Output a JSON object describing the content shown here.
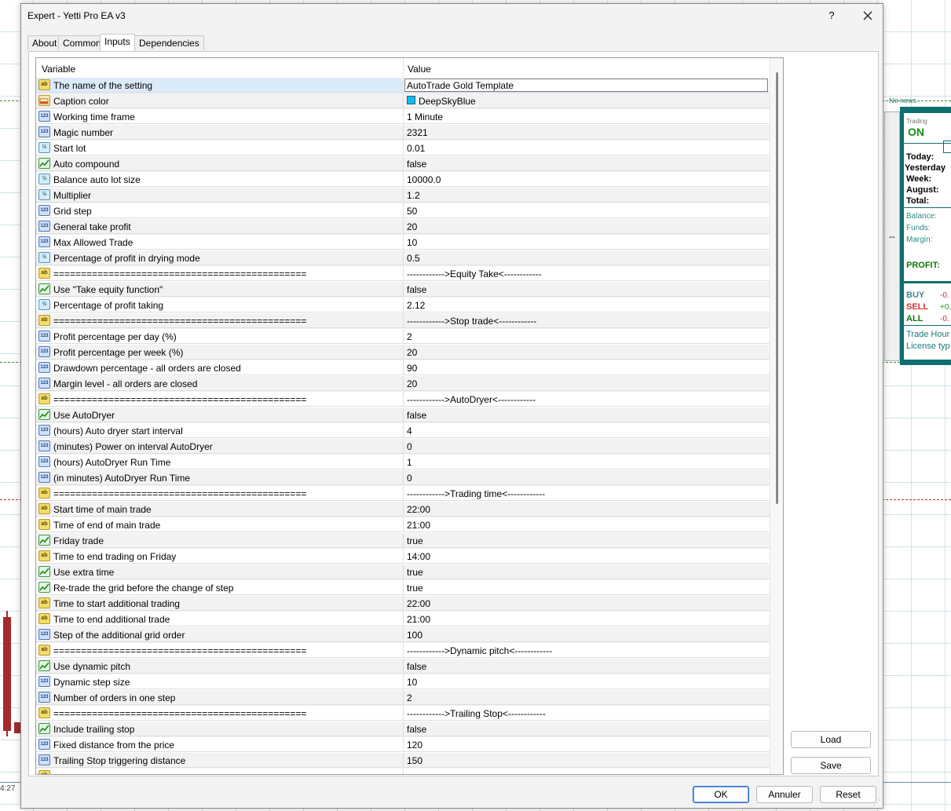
{
  "dialog": {
    "title": "Expert - Yetti Pro EA v3",
    "help_label": "?",
    "tabs": [
      {
        "label": "About"
      },
      {
        "label": "Common"
      },
      {
        "label": "Inputs"
      },
      {
        "label": "Dependencies"
      }
    ],
    "active_tab": "Inputs",
    "buttons": {
      "load": "Load",
      "save": "Save",
      "ok": "OK",
      "cancel": "Annuler",
      "reset": "Reset"
    }
  },
  "grid": {
    "columns": {
      "variable": "Variable",
      "value": "Value"
    },
    "rows": [
      {
        "icon": "ab",
        "variable": "The name of the setting",
        "value": "AutoTrade Gold Template",
        "editing": true
      },
      {
        "icon": "color",
        "variable": "Caption color",
        "value": "DeepSkyBlue",
        "swatch": "#00bfff"
      },
      {
        "icon": "n123",
        "variable": "Working time frame",
        "value": "1 Minute"
      },
      {
        "icon": "n123",
        "variable": "Magic number",
        "value": "2321"
      },
      {
        "icon": "frac",
        "variable": "Start lot",
        "value": "0.01"
      },
      {
        "icon": "bool",
        "variable": "Auto compound",
        "value": "false"
      },
      {
        "icon": "frac",
        "variable": "Balance auto lot size",
        "value": "10000.0"
      },
      {
        "icon": "frac",
        "variable": "Multiplier",
        "value": "1.2"
      },
      {
        "icon": "n123",
        "variable": "Grid step",
        "value": "50"
      },
      {
        "icon": "n123",
        "variable": "General take profit",
        "value": "20"
      },
      {
        "icon": "n123",
        "variable": "Max Allowed Trade",
        "value": "10"
      },
      {
        "icon": "frac",
        "variable": "Percentage of profit in drying mode",
        "value": "0.5"
      },
      {
        "icon": "ab",
        "variable": "==============================================",
        "value": "------------>Equity Take<------------"
      },
      {
        "icon": "bool",
        "variable": "Use \"Take equity function\"",
        "value": "false"
      },
      {
        "icon": "frac",
        "variable": "Percentage of profit taking",
        "value": "2.12"
      },
      {
        "icon": "ab",
        "variable": "==============================================",
        "value": "------------>Stop trade<------------"
      },
      {
        "icon": "n123",
        "variable": "Profit percentage per day (%)",
        "value": "2"
      },
      {
        "icon": "n123",
        "variable": "Profit percentage per week (%)",
        "value": "20"
      },
      {
        "icon": "n123",
        "variable": "Drawdown percentage - all orders are closed",
        "value": "90"
      },
      {
        "icon": "n123",
        "variable": "Margin level - all orders are closed",
        "value": "20"
      },
      {
        "icon": "ab",
        "variable": "==============================================",
        "value": "------------>AutoDryer<------------"
      },
      {
        "icon": "bool",
        "variable": "Use AutoDryer",
        "value": "false"
      },
      {
        "icon": "n123",
        "variable": "(hours) Auto dryer start interval",
        "value": "4"
      },
      {
        "icon": "n123",
        "variable": "(minutes) Power on interval AutoDryer",
        "value": "0"
      },
      {
        "icon": "n123",
        "variable": "(hours) AutoDryer Run Time",
        "value": "1"
      },
      {
        "icon": "n123",
        "variable": "(in minutes) AutoDryer Run Time",
        "value": "0"
      },
      {
        "icon": "ab",
        "variable": "==============================================",
        "value": "------------>Trading time<------------"
      },
      {
        "icon": "ab",
        "variable": "Start time of main trade",
        "value": "22:00"
      },
      {
        "icon": "ab",
        "variable": "Time of end of main trade",
        "value": "21:00"
      },
      {
        "icon": "bool",
        "variable": "Friday trade",
        "value": "true"
      },
      {
        "icon": "ab",
        "variable": "Time to end trading on Friday",
        "value": "14:00"
      },
      {
        "icon": "bool",
        "variable": "Use extra time",
        "value": "true"
      },
      {
        "icon": "bool",
        "variable": "Re-trade the grid before the change of step",
        "value": "true"
      },
      {
        "icon": "ab",
        "variable": "Time to start additional trading",
        "value": "22:00"
      },
      {
        "icon": "ab",
        "variable": "Time to end additional trade",
        "value": "21:00"
      },
      {
        "icon": "n123",
        "variable": "Step of the additional grid order",
        "value": "100"
      },
      {
        "icon": "ab",
        "variable": "==============================================",
        "value": "------------>Dynamic pitch<------------"
      },
      {
        "icon": "bool",
        "variable": "Use dynamic pitch",
        "value": "false"
      },
      {
        "icon": "n123",
        "variable": "Dynamic step size",
        "value": "10"
      },
      {
        "icon": "n123",
        "variable": "Number of orders in one step",
        "value": "2"
      },
      {
        "icon": "ab",
        "variable": "==============================================",
        "value": "------------>Trailing Stop<------------"
      },
      {
        "icon": "bool",
        "variable": "Include trailing stop",
        "value": "false"
      },
      {
        "icon": "n123",
        "variable": "Fixed distance from the price",
        "value": "120"
      },
      {
        "icon": "n123",
        "variable": "Trailing Stop triggering distance",
        "value": "150"
      },
      {
        "icon": "ab",
        "variable": "",
        "value": ""
      }
    ]
  },
  "icon_labels": {
    "ab": "ab",
    "n123": "123",
    "frac": "½",
    "bool": "",
    "color": ""
  },
  "icon_names": {
    "ab": "string-type-icon",
    "n123": "integer-type-icon",
    "frac": "double-type-icon",
    "bool": "boolean-type-icon",
    "color": "color-type-icon"
  },
  "chart": {
    "no_news": "No news",
    "time_label": "4:27"
  },
  "info_panel": {
    "trading_label": "Trading",
    "trading_status": "ON",
    "periods": [
      "Today:",
      "Yesterday",
      "Week:",
      "August:",
      "Total:"
    ],
    "account": [
      "Balance:",
      "Funds:",
      "Margin:"
    ],
    "profit_label": "PROFIT:",
    "trades": [
      {
        "label": "BUY",
        "value": "-0.",
        "color": "#3a8a9a",
        "value_color": "#c23030"
      },
      {
        "label": "SELL",
        "value": "+0.",
        "color": "#d83030",
        "value_color": "#1a9a1a"
      },
      {
        "label": "ALL",
        "value": "-0.",
        "color": "#0b7a0b",
        "value_color": "#c23030"
      }
    ],
    "footer": [
      "Trade Hour",
      "License typ"
    ]
  },
  "colors": {
    "panel_accent": "#0f6e6e",
    "selection": "#dcebfa",
    "primary_button": "#2a6fcf"
  }
}
